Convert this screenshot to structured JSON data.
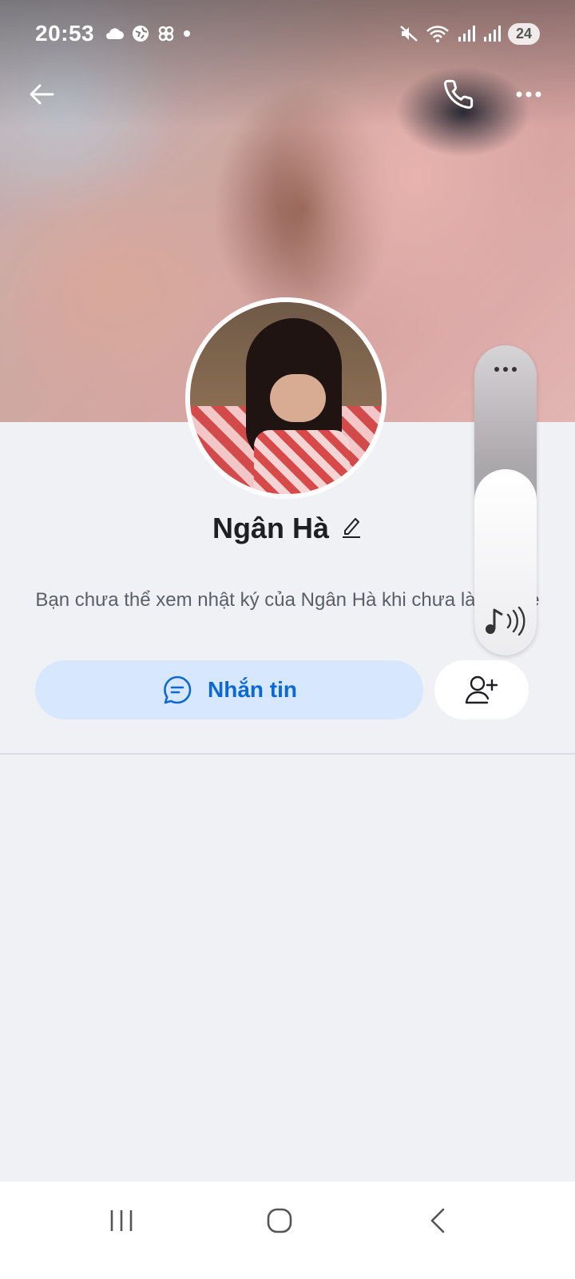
{
  "status_bar": {
    "time": "20:53",
    "battery": "24"
  },
  "profile": {
    "name": "Ngân Hà",
    "info_text": "Bạn chưa thể xem nhật ký của Ngân Hà khi chưa là bạn bè",
    "message_button_label": "Nhắn tin"
  },
  "icons": {
    "back": "back-arrow-icon",
    "call": "phone-icon",
    "more": "more-horizontal-icon",
    "edit": "pencil-icon",
    "message": "chat-bubble-icon",
    "add_friend": "add-user-icon",
    "volume_more": "more-horizontal-icon",
    "volume_media": "music-note-icon"
  },
  "volume": {
    "level": 0.6
  },
  "colors": {
    "accent": "#0b69d6",
    "message_button_bg": "#d7e8fe",
    "page_bg": "#f0f1f5"
  }
}
